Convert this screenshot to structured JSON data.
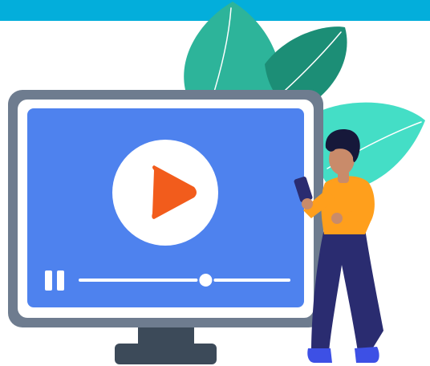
{
  "colors": {
    "top_band": "#03AEDB",
    "monitor_frame": "#6E7C8F",
    "monitor_screen": "#4E82EE",
    "monitor_stand": "#3C4A59",
    "play_circle": "#FFFFFF",
    "play_triangle": "#F25C1C",
    "progress_track": "#FFFFFF",
    "leaf_light": "#2DB49A",
    "leaf_dark": "#1C8E76",
    "leaf_mint": "#44DEC6",
    "person_sweater": "#FF9F1C",
    "person_pants": "#2A2C70",
    "person_hair": "#16183A",
    "person_skin": "#C98B6A",
    "person_shoes": "#3D50E5",
    "phone": "#2A2C70"
  },
  "icons": {
    "play": "play-icon",
    "pause": "pause-icon"
  },
  "player": {
    "progress_fraction": 0.6
  }
}
